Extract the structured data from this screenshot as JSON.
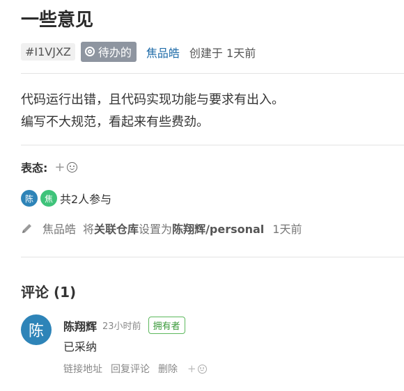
{
  "issue": {
    "title": "一些意见",
    "id": "#I1VJXZ",
    "state": "待办的",
    "author": "焦品皓",
    "created": "创建于 1天前",
    "description_lines": [
      "代码运行出错，且代码实现功能与要求有出入。",
      "编写不大规范，看起来有些费劲。"
    ]
  },
  "reactions": {
    "label": "表态:",
    "add": "+"
  },
  "participants": {
    "avatars": [
      {
        "char": "陈",
        "color": "#2e84b8"
      },
      {
        "char": "焦",
        "color": "#3fc37a"
      }
    ],
    "summary": "共2人参与"
  },
  "activity": {
    "icon": "pencil-icon",
    "actor": "焦品皓",
    "verb1": "将",
    "field": "关联仓库",
    "verb2": "设置为",
    "value": "陈翔辉/personal",
    "time": "1天前"
  },
  "comments": {
    "title": "评论 (1)",
    "items": [
      {
        "avatar_char": "陈",
        "avatar_color": "#2e84b8",
        "author": "陈翔辉",
        "time": "23小时前",
        "badge": "拥有者",
        "body": "已采纳",
        "actions": [
          "链接地址",
          "回复评论",
          "删除"
        ],
        "add": "+"
      }
    ]
  }
}
